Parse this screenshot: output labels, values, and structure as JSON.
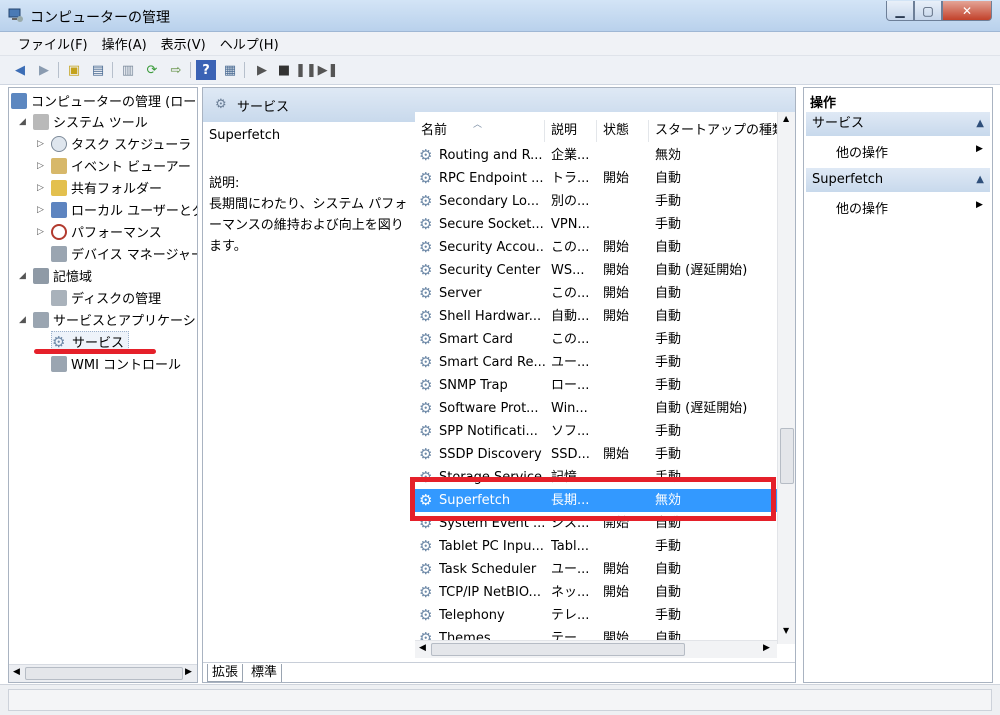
{
  "window": {
    "title": "コンピューターの管理"
  },
  "menu": [
    "ファイル(F)",
    "操作(A)",
    "表示(V)",
    "ヘルプ(H)"
  ],
  "tree": [
    {
      "label": "コンピューターの管理 (ロー",
      "icon": "computer-management-icon"
    },
    {
      "label": "システム ツール",
      "icon": "tools-icon"
    },
    {
      "label": "タスク スケジューラ",
      "icon": "clock-icon"
    },
    {
      "label": "イベント ビューアー",
      "icon": "event-viewer-icon"
    },
    {
      "label": "共有フォルダー",
      "icon": "shared-folder-icon"
    },
    {
      "label": "ローカル ユーザーとグ",
      "icon": "users-icon"
    },
    {
      "label": "パフォーマンス",
      "icon": "performance-icon"
    },
    {
      "label": "デバイス マネージャー",
      "icon": "device-manager-icon"
    },
    {
      "label": "記憶域",
      "icon": "storage-icon"
    },
    {
      "label": "ディスクの管理",
      "icon": "disk-icon"
    },
    {
      "label": "サービスとアプリケーシ",
      "icon": "services-apps-icon"
    },
    {
      "label": "サービス",
      "icon": "gear-icon"
    },
    {
      "label": "WMI コントロール",
      "icon": "wmi-icon"
    }
  ],
  "center": {
    "title": "サービス",
    "selected_name": "Superfetch",
    "desc_label": "説明:",
    "desc_text": "長期間にわたり、システム パフォーマンスの維持および向上を図ります。",
    "columns": [
      "名前",
      "説明",
      "状態",
      "スタートアップの種類"
    ],
    "rows": [
      {
        "name": "Routing and R...",
        "desc": "企業...",
        "status": "",
        "startup": "無効"
      },
      {
        "name": "RPC Endpoint ...",
        "desc": "トラ...",
        "status": "開始",
        "startup": "自動"
      },
      {
        "name": "Secondary Lo...",
        "desc": "別の...",
        "status": "",
        "startup": "手動"
      },
      {
        "name": "Secure Socket...",
        "desc": "VPN...",
        "status": "",
        "startup": "手動"
      },
      {
        "name": "Security Accou...",
        "desc": "この...",
        "status": "開始",
        "startup": "自動"
      },
      {
        "name": "Security Center",
        "desc": "WS...",
        "status": "開始",
        "startup": "自動 (遅延開始)"
      },
      {
        "name": "Server",
        "desc": "この...",
        "status": "開始",
        "startup": "自動"
      },
      {
        "name": "Shell Hardwar...",
        "desc": "自動...",
        "status": "開始",
        "startup": "自動"
      },
      {
        "name": "Smart Card",
        "desc": "この...",
        "status": "",
        "startup": "手動"
      },
      {
        "name": "Smart Card Re...",
        "desc": "ユー...",
        "status": "",
        "startup": "手動"
      },
      {
        "name": "SNMP Trap",
        "desc": "ロー...",
        "status": "",
        "startup": "手動"
      },
      {
        "name": "Software Prot...",
        "desc": "Win...",
        "status": "",
        "startup": "自動 (遅延開始)"
      },
      {
        "name": "SPP Notificati...",
        "desc": "ソフ...",
        "status": "",
        "startup": "手動"
      },
      {
        "name": "SSDP Discovery",
        "desc": "SSD...",
        "status": "開始",
        "startup": "手動"
      },
      {
        "name": "Storage Service",
        "desc": "記憶...",
        "status": "",
        "startup": "手動"
      },
      {
        "name": "Superfetch",
        "desc": "長期...",
        "status": "",
        "startup": "無効"
      },
      {
        "name": "System Event ...",
        "desc": "シス...",
        "status": "開始",
        "startup": "自動"
      },
      {
        "name": "Tablet PC Inpu...",
        "desc": "Tabl...",
        "status": "",
        "startup": "手動"
      },
      {
        "name": "Task Scheduler",
        "desc": "ユー...",
        "status": "開始",
        "startup": "自動"
      },
      {
        "name": "TCP/IP NetBIO...",
        "desc": "ネッ...",
        "status": "開始",
        "startup": "自動"
      },
      {
        "name": "Telephony",
        "desc": "テレ...",
        "status": "",
        "startup": "手動"
      },
      {
        "name": "Themes",
        "desc": "テー...",
        "status": "開始",
        "startup": "自動"
      }
    ],
    "tabs": [
      "拡張",
      "標準"
    ]
  },
  "actions": {
    "title": "操作",
    "sections": [
      {
        "header": "サービス",
        "item": "他の操作"
      },
      {
        "header": "Superfetch",
        "item": "他の操作"
      }
    ]
  },
  "colors": {
    "selection": "#3399ff",
    "annotation": "#e5202a",
    "header_bg": "#c8d9ec"
  }
}
